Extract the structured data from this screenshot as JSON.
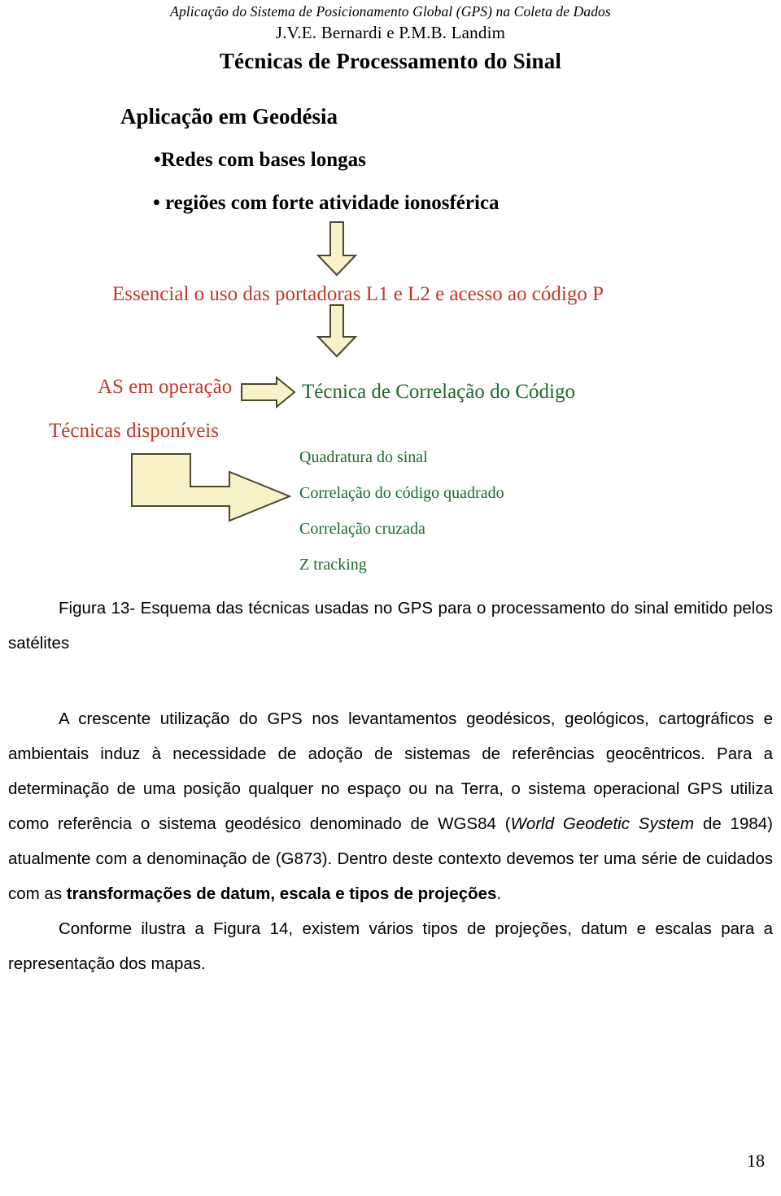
{
  "document": {
    "running_head": "Aplicação do Sistema de Posicionamento Global (GPS)  na Coleta de Dados",
    "authors": "J.V.E. Bernardi e P.M.B. Landim",
    "page_number": "18"
  },
  "slide": {
    "title": "Técnicas de Processamento do Sinal",
    "heading": "Aplicação em Geodésia",
    "bullets": [
      "•Redes com bases longas",
      "• regiões com forte atividade ionosférica"
    ],
    "emphasis_line": "Essencial o uso das portadoras L1 e L2 e acesso ao código P",
    "left_labels": [
      "AS em operação",
      "Técnicas disponíveis"
    ],
    "primary_technique": "Técnica de Correlação do Código",
    "techniques": [
      "Quadratura do sinal",
      "Correlação do código quadrado",
      "Correlação cruzada",
      "Z tracking"
    ],
    "colors": {
      "red_text": "#bf3a24",
      "green_text": "#1a6b2d",
      "arrow_fill": "#f7f2c8",
      "arrow_stroke": "#5b5737"
    }
  },
  "figure": {
    "caption": "Figura 13- Esquema das técnicas usadas no GPS para o processamento do sinal emitido pelos satélites"
  },
  "body": {
    "paragraph1_part1": "A crescente utilização do GPS nos levantamentos geodésicos, geológicos, cartográficos e ambientais induz à necessidade de adoção de sistemas de referências geocêntricos. Para a determinação de uma posição qualquer no espaço ou na Terra, o sistema operacional GPS utiliza como referência o sistema geodésico denominado de WGS84 (",
    "paragraph1_italic": "World Geodetic System",
    "paragraph1_part2": " de 1984) atualmente com a denominação de (G873). Dentro deste contexto devemos ter uma série de cuidados com as ",
    "paragraph1_bold": "transformações de datum, escala e tipos de projeções",
    "paragraph1_part3": ".",
    "paragraph2": "Conforme ilustra a Figura 14, existem vários tipos de projeções, datum e escalas para a representação dos mapas."
  }
}
